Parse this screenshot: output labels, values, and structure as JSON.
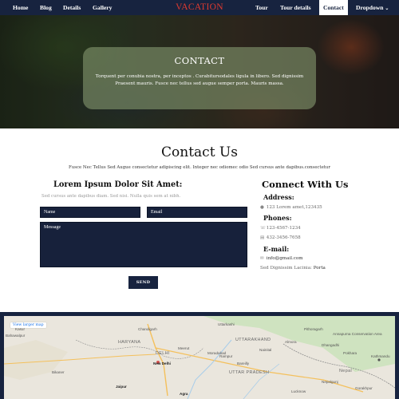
{
  "nav": {
    "left_items": [
      "Home",
      "Blog",
      "Details",
      "Gallery"
    ],
    "brand": "VACATION",
    "right_items": [
      "Tour",
      "Tour details",
      "Contact",
      "Dropdown"
    ],
    "dropdown_caret": "⌄",
    "active_item": "Contact"
  },
  "hero": {
    "title": "CONTACT",
    "text": "Torquent per conubia nostra, per inceptos . Curabitursodales ligula in libero. Sed dignissim Praesent mauris. Fusce nec tellus sed augue semper porta. Mauris massa."
  },
  "contact": {
    "title": "Contact Us",
    "subtitle": "Fusce Nec Tellus Sed Augue consectetur adipiscing elit. Integer nec odiomec odio Sed cursus ante dapibus.consectetur"
  },
  "form": {
    "heading": "Lorem Ipsum Dolor Sit Amet:",
    "subtext": "Sed cursus ante dapibus diam. Sed nisi. Nulla quis sem at nibh.",
    "name_placeholder": "Name",
    "email_placeholder": "Email",
    "message_placeholder": "Message",
    "send_label": "SEND"
  },
  "connect": {
    "heading": "Connect With Us",
    "address_label": "Address:",
    "address": "123 Lorem amet,123435",
    "phones_label": "Phones:",
    "phone1": "123-4567-1234",
    "phone2": "432-3456-7658",
    "email_label": "E-mail:",
    "email": "info@gmail.com",
    "tagline_prefix": "Sed Dignissim Lacinia:",
    "tagline_value": "Porta"
  },
  "map": {
    "link": "View larger map",
    "labels": [
      "Kasur",
      "Bahawalpur",
      "HARYANA",
      "DELHI",
      "New Delhi",
      "Bareilly",
      "UTTARAKHAND",
      "Almora",
      "Uttarkashi",
      "Pithoragarh",
      "Lucknow",
      "Gorakhpur",
      "UTTAR PRADESH",
      "Nepal",
      "Kathmandu",
      "Pokhara",
      "Bikaner",
      "Jaipur",
      "Agra",
      "Moradabad",
      "Meerut",
      "Rampur",
      "Dhangadhi",
      "Nainital",
      "Annapurna Conservation Area",
      "Nepalgunj",
      "Chandigarh"
    ],
    "colors": {
      "land": "#eae6dd",
      "green": "#cfe3c0",
      "road": "#f4c05c",
      "border": "#8e8e8e",
      "water": "#a8cdea"
    }
  },
  "colors": {
    "navy": "#17233f",
    "brand_red": "#e03a2f",
    "hero_card": "#829670"
  },
  "icons": {
    "address": "map-marker-icon",
    "phone": "phone-icon",
    "fax": "fax-icon",
    "email": "envelope-icon"
  }
}
